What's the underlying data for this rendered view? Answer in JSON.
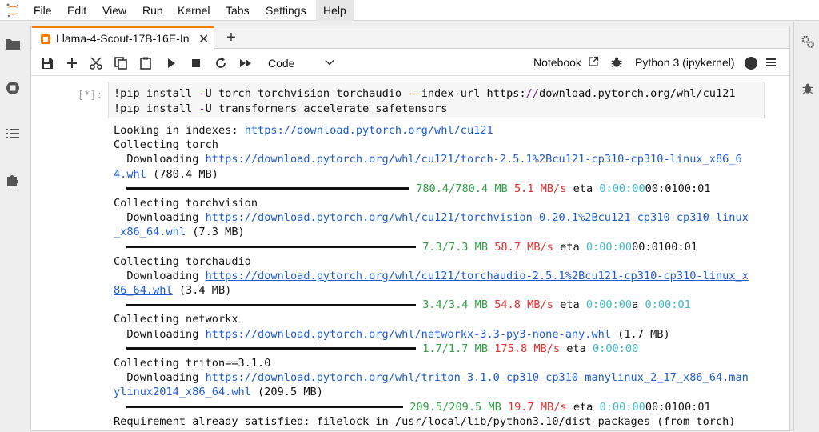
{
  "menubar": {
    "items": [
      "File",
      "Edit",
      "View",
      "Run",
      "Kernel",
      "Tabs",
      "Settings",
      "Help"
    ]
  },
  "tab": {
    "title": "Llama-4-Scout-17B-16E-In",
    "close": "✕",
    "add": "+"
  },
  "toolbar": {
    "cell_type": "Code",
    "notebook_label": "Notebook",
    "kernel_name": "Python 3 (ipykernel)"
  },
  "cell": {
    "prompt": "[*]:",
    "code": [
      "!pip install -U torch torchvision torchaudio --index-url https://download.pytorch.org/whl/cu121",
      "!pip install -U transformers accelerate safetensors"
    ]
  },
  "output": {
    "looking": "Looking in indexes: ",
    "index_url": "https://download.pytorch.org/whl/cu121",
    "torch": {
      "collecting": "Collecting torch",
      "dl_prefix": "  Downloading ",
      "url1": "https://download.pytorch.org/whl/cu121/torch-2.5.1%2Bcu121-cp310-cp310-linux_x86_6",
      "url2": "4.whl",
      "size": " (780.4 MB)",
      "done": "780.4/780.4 MB",
      "speed": "5.1 MB/s",
      "eta": "eta",
      "eta_time": "0:00:00",
      "tail": "00:0100:01"
    },
    "torchvision": {
      "collecting": "Collecting torchvision",
      "dl_prefix": "  Downloading ",
      "url1": "https://download.pytorch.org/whl/cu121/torchvision-0.20.1%2Bcu121-cp310-cp310-linux",
      "url2": "_x86_64.whl",
      "size": " (7.3 MB)",
      "done": "7.3/7.3 MB",
      "speed": "58.7 MB/s",
      "eta": "eta",
      "eta_time": "0:00:00",
      "tail": "00:0100:01"
    },
    "torchaudio": {
      "collecting": "Collecting torchaudio",
      "dl_prefix": "  Downloading ",
      "url1": "https://download.pytorch.org/whl/cu121/torchaudio-2.5.1%2Bcu121-cp310-cp310-linux_x",
      "url2": "86_64.whl",
      "size": " (3.4 MB)",
      "done": "3.4/3.4 MB",
      "speed": "54.8 MB/s",
      "eta": "eta",
      "eta_time": "0:00:00",
      "tail_a": "a",
      "tail_time": "0:00:01"
    },
    "networkx": {
      "collecting": "Collecting networkx",
      "dl_prefix": "  Downloading ",
      "url1": "https://download.pytorch.org/whl/networkx-3.3-py3-none-any.whl",
      "size": " (1.7 MB)",
      "done": "1.7/1.7 MB",
      "speed": "175.8 MB/s",
      "eta": "eta",
      "eta_time": "0:00:00"
    },
    "triton": {
      "collecting": "Collecting triton==3.1.0",
      "dl_prefix": "  Downloading ",
      "url1": "https://download.pytorch.org/whl/triton-3.1.0-cp310-cp310-manylinux_2_17_x86_64.man",
      "url2": "ylinux2014_x86_64.whl",
      "size": " (209.5 MB)",
      "done": "209.5/209.5 MB",
      "speed": "19.7 MB/s",
      "eta": "eta",
      "eta_time": "0:00:00",
      "tail": "00:0100:01"
    },
    "requirement": "Requirement already satisfied: filelock in /usr/local/lib/python3.10/dist-packages (from torch)"
  }
}
